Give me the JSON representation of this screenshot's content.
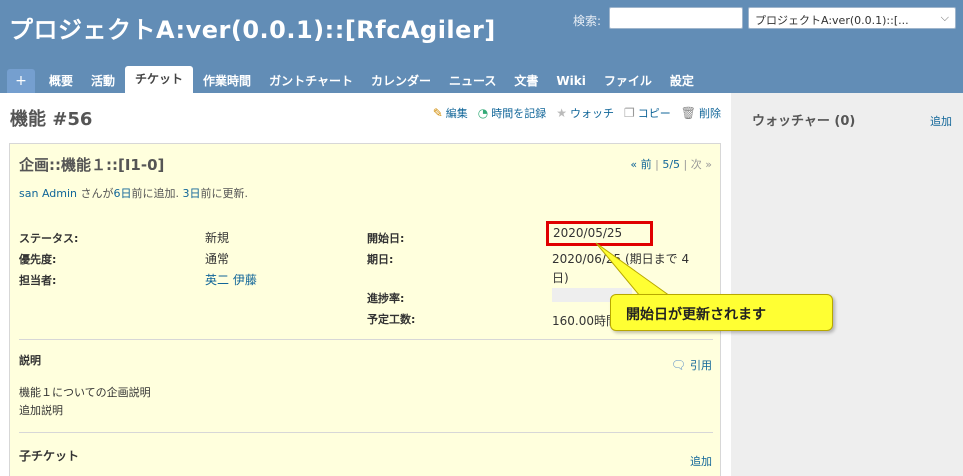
{
  "header": {
    "project_title": "プロジェクトA:ver(0.0.1)::[RfcAgiler]",
    "search_label": "検索:",
    "project_select_value": "プロジェクトA:ver(0.0.1)::[..."
  },
  "tabs": [
    {
      "label": "+"
    },
    {
      "label": "概要"
    },
    {
      "label": "活動"
    },
    {
      "label": "チケット"
    },
    {
      "label": "作業時間"
    },
    {
      "label": "ガントチャート"
    },
    {
      "label": "カレンダー"
    },
    {
      "label": "ニュース"
    },
    {
      "label": "文書"
    },
    {
      "label": "Wiki"
    },
    {
      "label": "ファイル"
    },
    {
      "label": "設定"
    }
  ],
  "issue": {
    "heading": "機能 #56",
    "actions": {
      "edit": "編集",
      "log_time": "時間を記録",
      "watch": "ウォッチ",
      "copy": "コピー",
      "delete": "削除"
    },
    "subject": "企画::機能１::[I1-0]",
    "nav": {
      "prev": "« 前",
      "sep1": "|",
      "position": "5/5",
      "sep2": "|",
      "next": "次 »"
    },
    "author": {
      "name": "san Admin",
      "text1": " さんが",
      "added_ago": "6日",
      "text2": "前に追加. ",
      "updated_ago": "3日",
      "text3": "前に更新."
    },
    "attributes": {
      "status_label": "ステータス:",
      "status_value": "新規",
      "priority_label": "優先度:",
      "priority_value": "通常",
      "assignee_label": "担当者:",
      "assignee_value": "英二 伊藤",
      "start_label": "開始日:",
      "start_value": "2020/05/25",
      "due_label": "期日:",
      "due_value_line1": "2020/06/25 (期日まで 4",
      "due_value_line2": "日)",
      "progress_label": "進捗率:",
      "progress_value": 0,
      "estimated_label": "予定工数:",
      "estimated_value": "160.00時間"
    },
    "description": {
      "title": "説明",
      "quote": "引用",
      "line1": "機能１についての企画説明",
      "line2": "追加説明"
    },
    "subtasks": {
      "title": "子チケット",
      "add": "追加"
    }
  },
  "sidebar": {
    "watchers_title": "ウォッチャー (0)",
    "watchers_add": "追加"
  },
  "callout": {
    "text": "開始日が更新されます"
  },
  "colors": {
    "header": "#628db6",
    "link": "#116699",
    "issue_bg": "#ffffdd",
    "highlight": "#e00000",
    "callout": "#ffff33"
  }
}
